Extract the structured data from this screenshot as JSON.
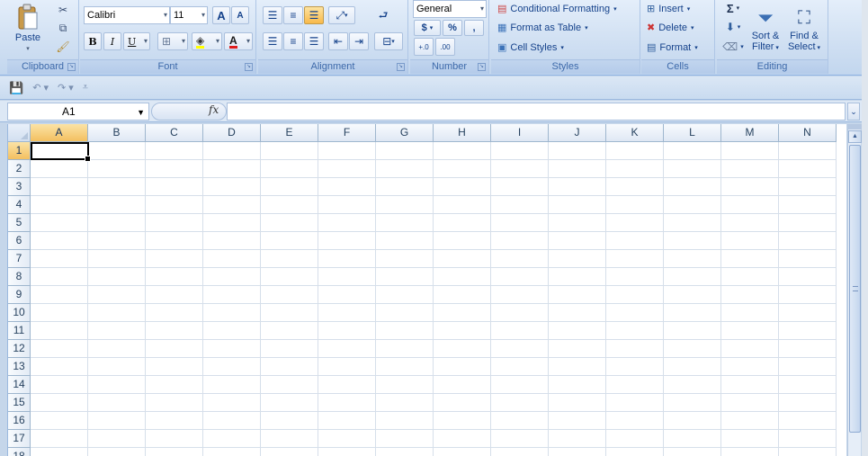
{
  "ribbon": {
    "clipboard": {
      "label": "Clipboard",
      "paste": "Paste"
    },
    "font": {
      "label": "Font",
      "family": "Calibri",
      "size": "11",
      "bold": "B",
      "italic": "I",
      "underline": "U",
      "grow": "A",
      "shrink": "A",
      "font_color": "A"
    },
    "alignment": {
      "label": "Alignment"
    },
    "number": {
      "label": "Number",
      "format": "General",
      "currency": "$",
      "percent": "%",
      "comma": ",",
      "inc_decimal": "+.0 .00",
      "dec_decimal": ".00 →.0"
    },
    "styles": {
      "label": "Styles",
      "conditional": "Conditional Formatting",
      "format_table": "Format as Table",
      "cell_styles": "Cell Styles"
    },
    "cells": {
      "label": "Cells",
      "insert": "Insert",
      "delete": "Delete",
      "format": "Format"
    },
    "editing": {
      "label": "Editing",
      "sort_filter_1": "Sort &",
      "sort_filter_2": "Filter",
      "find_select_1": "Find &",
      "find_select_2": "Select",
      "sigma": "Σ"
    }
  },
  "formula_bar": {
    "name_box": "A1",
    "fx": "fx",
    "formula": ""
  },
  "grid": {
    "columns": [
      "A",
      "B",
      "C",
      "D",
      "E",
      "F",
      "G",
      "H",
      "I",
      "J",
      "K",
      "L",
      "M",
      "N"
    ],
    "rows": [
      "1",
      "2",
      "3",
      "4",
      "5",
      "6",
      "7",
      "8",
      "9",
      "10",
      "11",
      "12",
      "13",
      "14",
      "15",
      "16",
      "17",
      "18"
    ],
    "selected_cell": "A1"
  }
}
